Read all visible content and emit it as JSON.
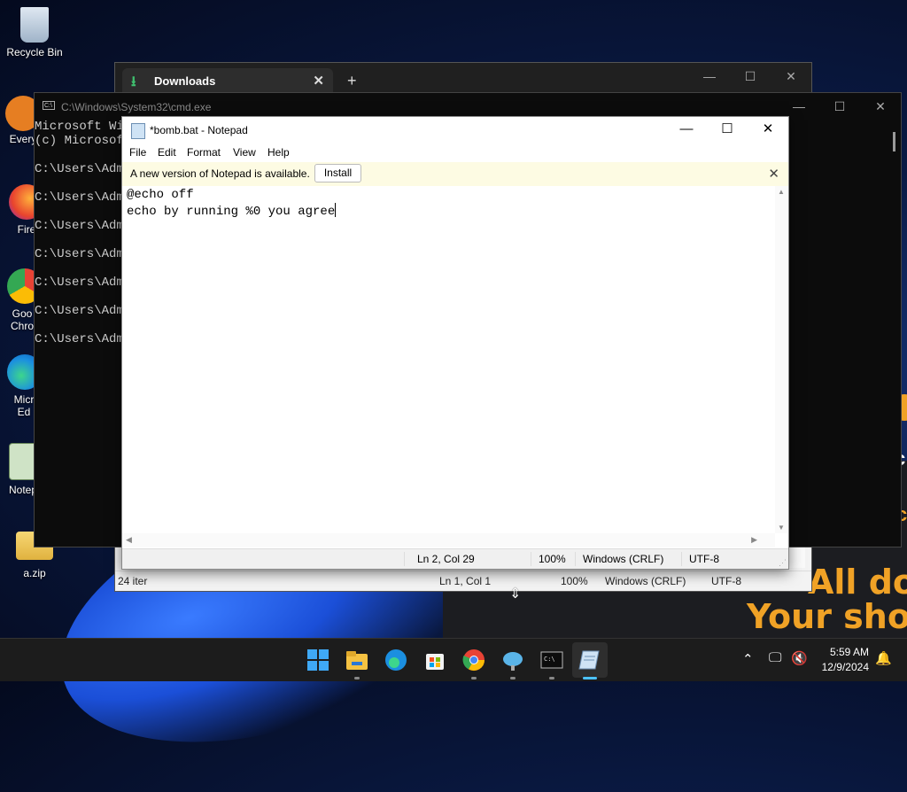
{
  "desktop": {
    "icons": [
      {
        "label": "Recycle Bin"
      },
      {
        "label": "Every"
      },
      {
        "label": "Fire"
      },
      {
        "label": "Goo Chro"
      },
      {
        "label": "Micr Ed"
      },
      {
        "label": "Notep"
      },
      {
        "label": "a.zip"
      }
    ],
    "promo": {
      "line1": "All dor",
      "line2": "Your shor"
    }
  },
  "explorer": {
    "tab_label": "Downloads",
    "status": {
      "items": "24 iter",
      "position": "Ln 1, Col 1",
      "zoom": "100%",
      "line_ending": "Windows (CRLF)",
      "encoding": "UTF-8"
    }
  },
  "cmd": {
    "title": "C:\\Windows\\System32\\cmd.exe",
    "lines": [
      "Microsoft Wi",
      "(c) Microsof",
      "",
      "C:\\Users\\Adm",
      "",
      "C:\\Users\\Adm",
      "",
      "C:\\Users\\Adm",
      "",
      "C:\\Users\\Adm",
      "",
      "C:\\Users\\Adm",
      "",
      "C:\\Users\\Adm",
      "",
      "C:\\Users\\Adm"
    ]
  },
  "notepad": {
    "title": "*bomb.bat - Notepad",
    "menu": [
      "File",
      "Edit",
      "Format",
      "View",
      "Help"
    ],
    "banner": {
      "message": "A new version of Notepad is available.",
      "button": "Install"
    },
    "content_lines": [
      "@echo off",
      "echo by running %0 you agree"
    ],
    "status": {
      "position": "Ln 2, Col 29",
      "zoom": "100%",
      "line_ending": "Windows (CRLF)",
      "encoding": "UTF-8"
    }
  },
  "taskbar": {
    "apps": [
      "start-icon",
      "file-explorer-icon",
      "edge-icon",
      "store-icon",
      "chrome-icon",
      "network-icon",
      "terminal-icon",
      "notepad-icon"
    ],
    "clock": {
      "time": "5:59 AM",
      "date": "12/9/2024"
    }
  },
  "colors": {
    "accent": "#4cc2ff",
    "promo": "#f0a226",
    "banner": "#fdfbe3"
  }
}
